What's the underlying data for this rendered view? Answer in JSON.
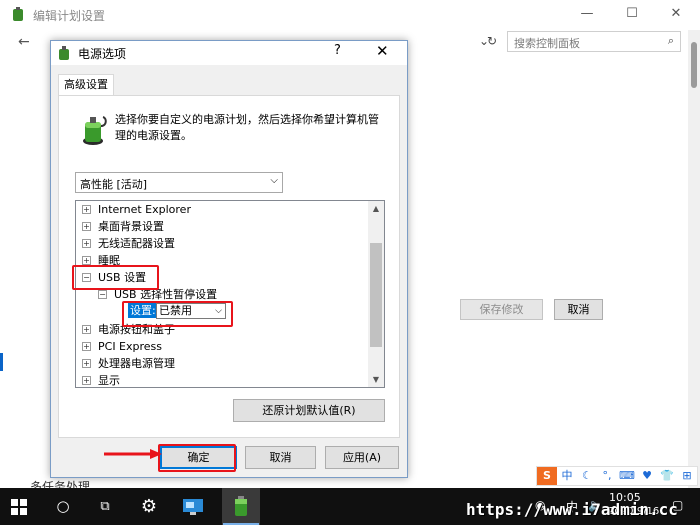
{
  "background_window": {
    "title": "编辑计划设置",
    "search_placeholder": "搜索控制面板",
    "save_button": "保存修改",
    "cancel_button": "取消",
    "bottom_text": "多任务处理"
  },
  "dialog": {
    "title": "电源选项",
    "help": "?",
    "close": "✕",
    "tab": "高级设置",
    "description": "选择你要自定义的电源计划，然后选择你希望计算机管理的电源设置。",
    "plan_select": "高性能 [活动]",
    "tree": [
      {
        "label": "Internet Explorer",
        "expander": "+"
      },
      {
        "label": "桌面背景设置",
        "expander": "+"
      },
      {
        "label": "无线适配器设置",
        "expander": "+"
      },
      {
        "label": "睡眠",
        "expander": "+"
      },
      {
        "label": "USB 设置",
        "expander": "−"
      },
      {
        "label": "USB 选择性暂停设置",
        "expander": "−"
      },
      {
        "label": "电源按钮和盖子",
        "expander": "+"
      },
      {
        "label": "PCI Express",
        "expander": "+"
      },
      {
        "label": "处理器电源管理",
        "expander": "+"
      },
      {
        "label": "显示",
        "expander": "+"
      }
    ],
    "setting_label": "设置:",
    "setting_value": "已禁用",
    "restore_button": "还原计划默认值(R)",
    "ok_button": "确定",
    "cancel_button": "取消",
    "apply_button": "应用(A)"
  },
  "taskbar": {
    "time": "10:05",
    "date": "2020/9/16",
    "watermark": "https://www.i7admin.cc",
    "tray": [
      "S",
      "中",
      "☾",
      "°,",
      "⌨",
      "♥",
      "👕",
      "⊞"
    ]
  },
  "colors": {
    "highlight_red": "#e8141b",
    "selection_blue": "#0078d7",
    "taskbar": "#101010"
  }
}
